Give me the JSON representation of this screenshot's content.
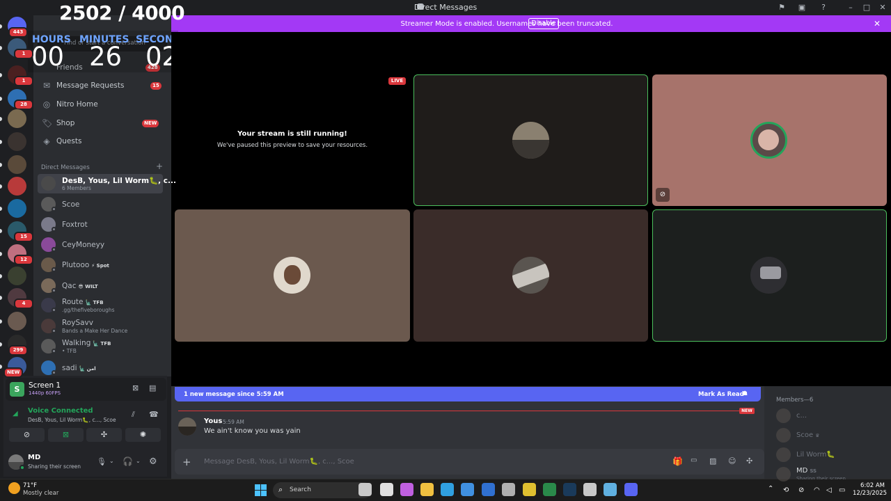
{
  "window": {
    "title": "Direct Messages"
  },
  "banner": {
    "text": "Streamer Mode is enabled. Usernames have been truncated.",
    "button": "Disable"
  },
  "overlay": {
    "counter": "2502 / 4000",
    "labels": {
      "hours": "HOURS",
      "minutes": "MINUTES",
      "seconds": "SECONDS"
    },
    "values": {
      "hours": "00",
      "minutes": "26",
      "seconds": "02"
    }
  },
  "guilds": [
    {
      "badge": "443",
      "color": "#5865f2"
    },
    {
      "badge": "1",
      "color": "#3b5a7a"
    },
    {
      "badge": "1",
      "color": "#4a2020"
    },
    {
      "badge": "28",
      "color": "#2e6fb3"
    },
    {
      "badge": "",
      "color": "#7a6a50"
    },
    {
      "badge": "",
      "color": "#3a3330"
    },
    {
      "badge": "",
      "color": "#5a4a3a"
    },
    {
      "badge": "",
      "color": "#b83a3a"
    },
    {
      "badge": "",
      "color": "#1a6aa0"
    },
    {
      "badge": "15",
      "color": "#2a5a6a"
    },
    {
      "badge": "12",
      "color": "#c07080"
    },
    {
      "badge": "",
      "color": "#3a4030"
    },
    {
      "badge": "4",
      "color": "#503a40"
    },
    {
      "badge": "",
      "color": "#6a5a50"
    },
    {
      "badge": "299",
      "color": "#2a2a2a"
    },
    {
      "badge": "NEW",
      "color": "#3a5a9a"
    }
  ],
  "sidebar": {
    "search_placeholder": "Find or start a conversation",
    "friends": {
      "label": "Friends",
      "badge": "428"
    },
    "nav": [
      {
        "label": "Message Requests",
        "badge": "15"
      },
      {
        "label": "Nitro Home",
        "badge": ""
      },
      {
        "label": "Shop",
        "badge": "NEW"
      },
      {
        "label": "Quests",
        "badge": ""
      }
    ],
    "dm_header": "Direct Messages",
    "dm_add": "+",
    "dms": [
      {
        "name": "DesB, Yous, Lil Worm🐛, c...",
        "sub": "6 Members",
        "tag": "",
        "color": "#4a4a4a"
      },
      {
        "name": "Scoe",
        "sub": "",
        "tag": "",
        "color": "#5a5a5a"
      },
      {
        "name": "Foxtrot",
        "sub": "",
        "tag": "",
        "color": "#7a7a8a"
      },
      {
        "name": "CeyMoneyy",
        "sub": "",
        "tag": "",
        "color": "#8a4a9a"
      },
      {
        "name": "Plutooo",
        "sub": "",
        "tag": "⚡ Spot",
        "color": "#6a5a4a"
      },
      {
        "name": "Qac",
        "sub": "",
        "tag": "😎 WILT",
        "color": "#7a6a5a"
      },
      {
        "name": "Route",
        "sub": ".gg/thefiveboroughs",
        "tag": "🗽 TFB",
        "color": "#3a3a4a"
      },
      {
        "name": "RoySavv",
        "sub": "Bands a Make Her Dance",
        "tag": "",
        "color": "#4a3a3a"
      },
      {
        "name": "Walking",
        "sub": "• TFB",
        "tag": "🗽 TFB",
        "color": "#5a5a5a"
      },
      {
        "name": "sadi",
        "sub": "",
        "tag": "🗽 امن",
        "color": "#2e6fb3"
      }
    ]
  },
  "screen_card": {
    "title": "Screen 1",
    "quality": "1440p 60FPS"
  },
  "voice": {
    "status": "Voice Connected",
    "channel": "DesB, Yous, Lil Worm🐛, c..., Scoe"
  },
  "user": {
    "name": "MD",
    "status": "Sharing their screen"
  },
  "stage": {
    "live": "LIVE",
    "paused_title": "Your stream is still running!",
    "paused_sub": "We've paused this preview to save your resources."
  },
  "chat": {
    "new_bar": "1 new message since 5:59 AM",
    "mark_read": "Mark As Read",
    "new_tag": "NEW",
    "message": {
      "author": "Yous",
      "time": "5:59 AM",
      "text": "We ain't know you was yain"
    },
    "input_placeholder": "Message DesB, Yous, Lil Worm🐛, c..., Scoe"
  },
  "members": {
    "header": "Members—6",
    "list": [
      {
        "name": "c...",
        "tag": ""
      },
      {
        "name": "Scoe",
        "tag": "♛"
      },
      {
        "name": "Lil Worm🐛",
        "tag": ""
      },
      {
        "name": "MD",
        "tag": "SS",
        "sub": "Sharing their screen"
      }
    ]
  },
  "taskbar": {
    "weather": {
      "temp": "71°F",
      "desc": "Mostly clear"
    },
    "search": "Search",
    "time": "6:02 AM",
    "date": "12/23/2025"
  }
}
